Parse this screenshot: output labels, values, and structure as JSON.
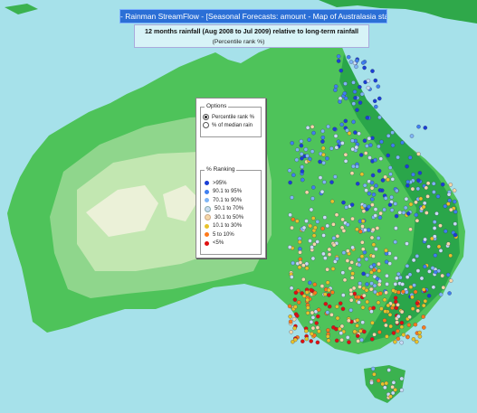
{
  "window": {
    "title": "- Rainman StreamFlow - [Seasonal Forecasts: amount - Map of Australasia stations]"
  },
  "map": {
    "subtitle": "12 months rainfall (Aug 2008 to Jul 2009) relative to long-term rainfall",
    "subsubtitle": "(Percentile rank %)"
  },
  "options": {
    "title": "Options",
    "items": [
      {
        "label": "Percentile rank %",
        "selected": true
      },
      {
        "label": "% of median rain",
        "selected": false
      }
    ]
  },
  "ranking": {
    "title": "% Ranking",
    "items": [
      {
        "label": ">95%",
        "color": "#1a3fd6"
      },
      {
        "label": "90.1 to 95%",
        "color": "#3f7ff0"
      },
      {
        "label": "70.1 to 90%",
        "color": "#7fb5f5"
      },
      {
        "label": "50.1 to 70%",
        "color": "#c8dcf4"
      },
      {
        "label": "30.1 to 50%",
        "color": "#f5d7a8"
      },
      {
        "label": "10.1 to 30%",
        "color": "#e8c22a"
      },
      {
        "label": "5 to 10%",
        "color": "#ff7a1a"
      },
      {
        "label": "<5%",
        "color": "#e01010"
      }
    ]
  }
}
